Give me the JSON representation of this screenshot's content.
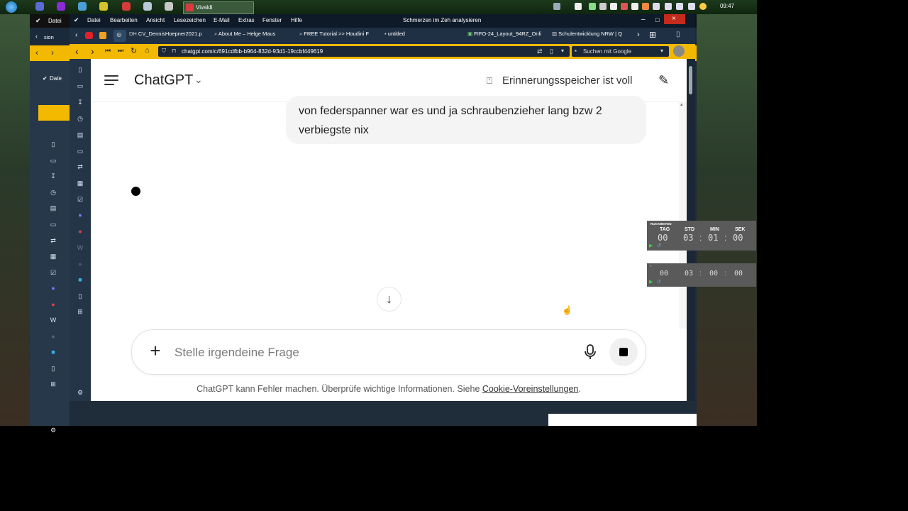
{
  "taskbar": {
    "clock": "09:47",
    "vivaldi_task": "Vivaldi"
  },
  "back_window": {
    "menu_label": "Datei",
    "tab_label": "sion",
    "panel_label": "Date"
  },
  "window": {
    "title": "Schmerzen im Zeh analysieren",
    "menu": [
      "Datei",
      "Bearbeiten",
      "Ansicht",
      "Lesezeichen",
      "E-Mail",
      "Extras",
      "Fenster",
      "Hilfe"
    ],
    "tabs": [
      "CV_DennisHoepner2021.p",
      "About Me – Helge Maus",
      "FREE Tutorial >> Houdini F",
      "untitled",
      "FIFO-24_Layout_94RZ_Onli",
      "Schulentwicklung NRW | Q"
    ],
    "url": "chatgpt.com/c/691cdfbb-b964-832d-93d1-19ccbf449619",
    "search_placeholder": "Suchen mit Google"
  },
  "chat": {
    "app_title": "ChatGPT",
    "memory_status": "Erinnerungsspeicher ist voll",
    "user_message": "von federspanner war es und ja schraubenzieher lang bzw 2 verbiegste nix",
    "input_placeholder": "Stelle irgendeine Frage",
    "footer_text": "ChatGPT kann Fehler machen. Überprüfe wichtige Informationen. Siehe ",
    "footer_link": "Cookie-Voreinstellungen",
    "footer_end": "."
  },
  "countdown": {
    "header": "RUCKBEITEN",
    "labels": [
      "TAG",
      "STD",
      "MIN",
      "SEK"
    ],
    "values": [
      "00",
      "03",
      "01",
      "00"
    ],
    "values2": [
      "00",
      "03",
      "00",
      "00"
    ]
  },
  "colors": {
    "accent": "#f3b900",
    "panel": "#233547"
  }
}
